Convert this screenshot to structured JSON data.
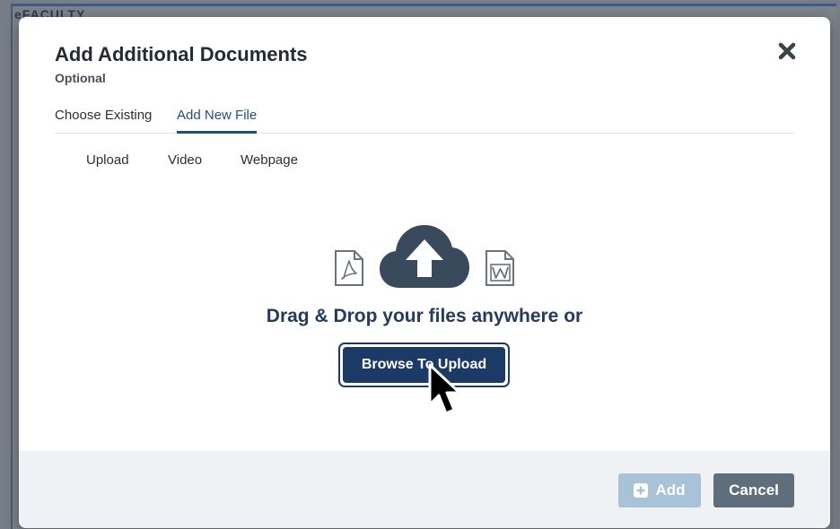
{
  "background": {
    "app_title": "eFACULTY"
  },
  "modal": {
    "title": "Add Additional Documents",
    "subtitle": "Optional",
    "tabs": [
      {
        "label": "Choose Existing",
        "active": false
      },
      {
        "label": "Add New File",
        "active": true
      }
    ],
    "subtabs": [
      {
        "label": "Upload"
      },
      {
        "label": "Video"
      },
      {
        "label": "Webpage"
      }
    ],
    "drop_zone": {
      "icons": [
        "pdf-file-icon",
        "cloud-upload-icon",
        "word-file-icon"
      ],
      "text": "Drag & Drop your files anywhere or",
      "browse_label": "Browse To Upload"
    },
    "footer": {
      "add_label": "Add",
      "cancel_label": "Cancel"
    }
  },
  "colors": {
    "primary": "#1b3a66",
    "tab_active": "#22507a",
    "add_disabled": "#a8c2d8",
    "cancel": "#5f6e7c",
    "footer_bg": "#f0f1f4"
  }
}
